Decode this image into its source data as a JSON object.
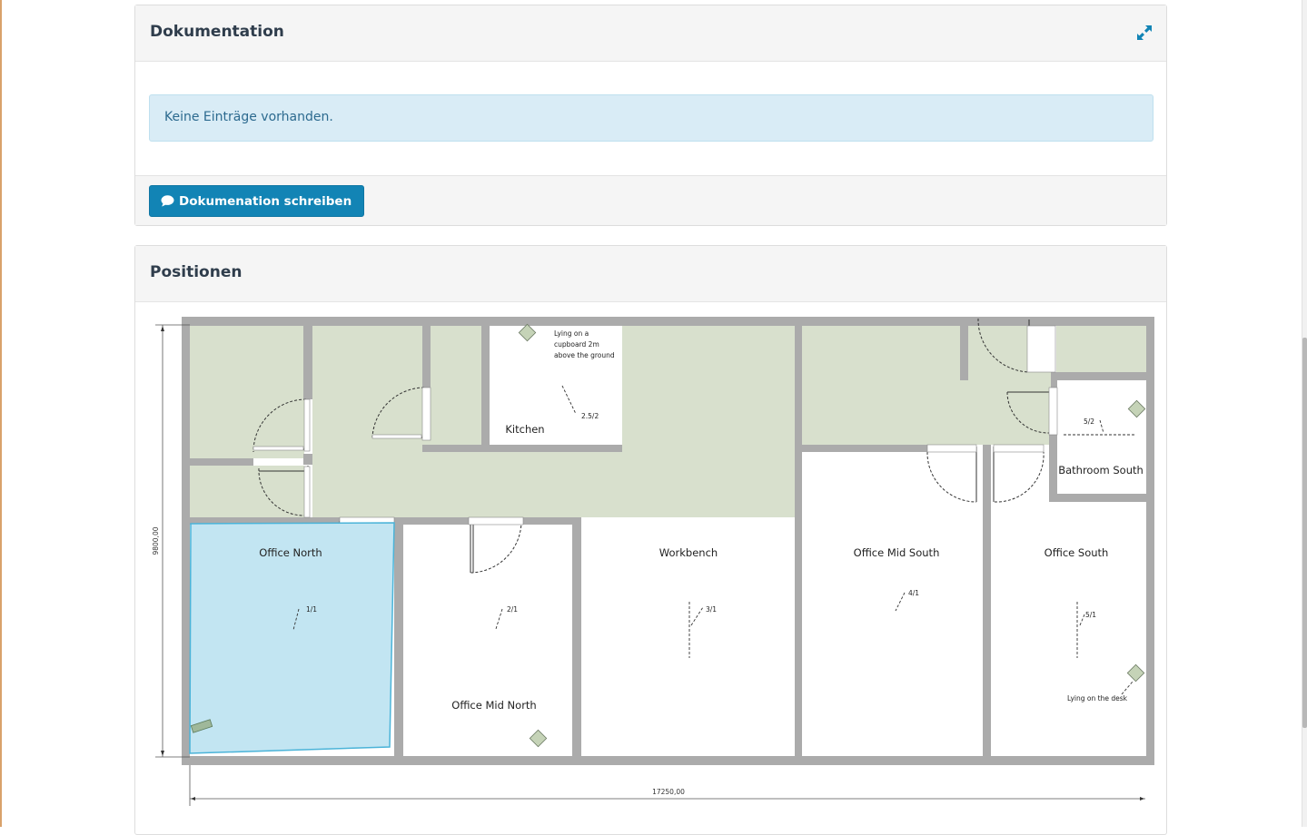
{
  "documentation": {
    "title": "Dokumentation",
    "empty_message": "Keine Einträge vorhanden.",
    "write_button_label": "Dokumenation schreiben",
    "expand_icon": "expand-icon",
    "comment_icon": "comment-icon"
  },
  "positions": {
    "title": "Positionen",
    "floorplan": {
      "rooms": {
        "office_north": "Office North",
        "office_mid_north": "Office Mid North",
        "workbench": "Workbench",
        "office_mid_south": "Office Mid South",
        "office_south": "Office South",
        "kitchen": "Kitchen",
        "bathroom_south": "Bathroom South"
      },
      "markers": {
        "office_north": "1/1",
        "office_mid_north": "2/1",
        "workbench": "3/1",
        "office_mid_south": "4/1",
        "office_south": "5/1",
        "kitchen": "2.5/2",
        "bathroom_south": "5/2"
      },
      "notes": {
        "kitchen_line1": "Lying on a",
        "kitchen_line2": "cupboard 2m",
        "kitchen_line3": "above the ground",
        "office_south": "Lying on the desk"
      },
      "dimensions": {
        "width": "17250,00",
        "height": "9800,00"
      },
      "colors": {
        "wall": "#ababab",
        "corridor": "#d8e0cd",
        "selected_room": "#c2e5f2",
        "selected_outline": "#4ab3d8"
      }
    }
  }
}
